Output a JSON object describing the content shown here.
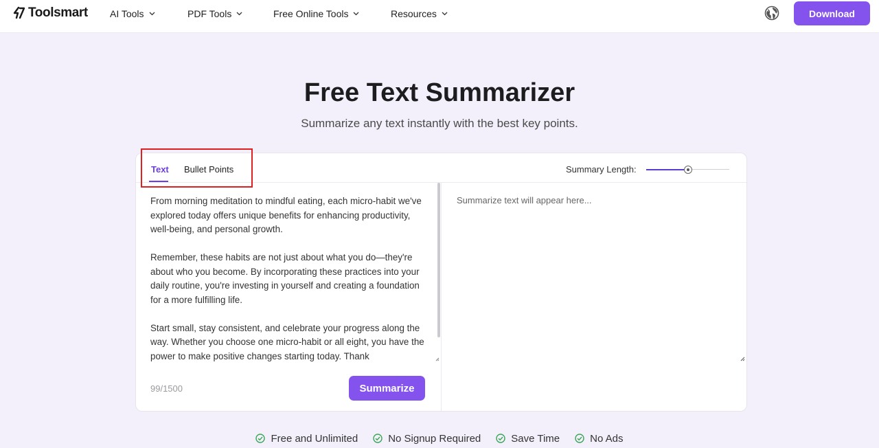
{
  "header": {
    "logo": "Toolsmart",
    "nav": [
      {
        "label": "AI Tools"
      },
      {
        "label": "PDF Tools"
      },
      {
        "label": "Free Online Tools"
      },
      {
        "label": "Resources"
      }
    ],
    "download_label": "Download",
    "accent_color": "#8453ee"
  },
  "hero": {
    "title": "Free Text Summarizer",
    "subtitle": "Summarize any text instantly with the best key points."
  },
  "card": {
    "tabs": [
      {
        "label": "Text",
        "active": true
      },
      {
        "label": "Bullet Points",
        "active": false
      }
    ],
    "summary_length_label": "Summary Length:",
    "summary_length_value": 0.5,
    "input_paragraphs": [
      "From morning meditation to mindful eating, each micro-habit we've explored today offers unique benefits for enhancing productivity, well-being, and personal growth.",
      "Remember, these habits are not just about what you do—they're about who you become. By incorporating these practices into your daily routine, you're investing in yourself and creating a foundation for a more fulfilling life.",
      "Start small, stay consistent, and celebrate your progress along the way. Whether you choose one micro-habit or all eight, you have the power to make positive changes starting today. Thank"
    ],
    "char_count": "99/1500",
    "summarize_label": "Summarize",
    "output_placeholder": "Summarize text will appear here..."
  },
  "features": [
    {
      "label": "Free and Unlimited",
      "icon": "check-circle-icon"
    },
    {
      "label": "No Signup Required",
      "icon": "check-circle-icon"
    },
    {
      "label": "Save Time",
      "icon": "check-circle-icon"
    },
    {
      "label": "No Ads",
      "icon": "check-circle-icon"
    }
  ]
}
